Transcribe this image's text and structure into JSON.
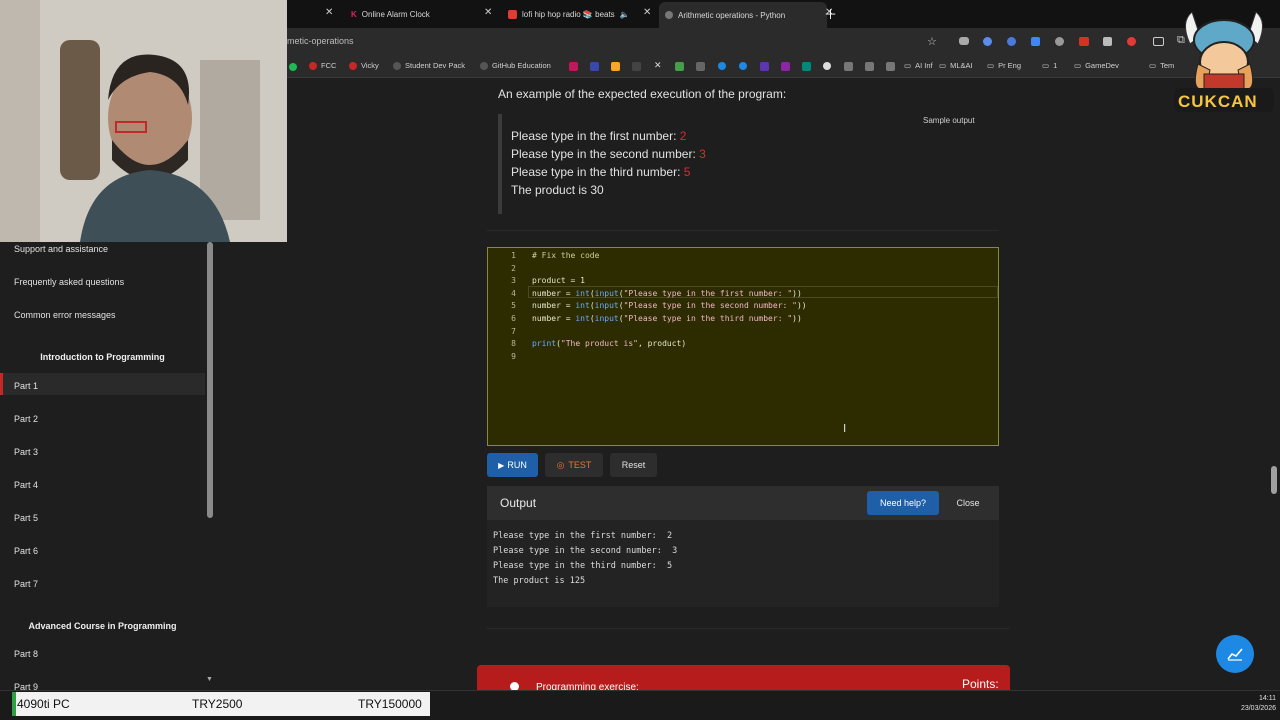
{
  "browser": {
    "tabs": [
      {
        "label": "Online Alarm Clock",
        "active": false
      },
      {
        "label": "lofi hip hop radio 📚 beats",
        "active": false
      },
      {
        "label": "Arithmetic operations - Python",
        "active": true
      }
    ],
    "url": "metic-operations",
    "bookmarks": [
      "FCC",
      "Vicky",
      "Student Dev Pack",
      "GitHub Education",
      "AI Inf",
      "ML&AI",
      "Pr Eng",
      "1",
      "GameDev",
      "Tem"
    ]
  },
  "sidebar": {
    "items_top": [
      "Support and assistance",
      "Frequently asked questions",
      "Common error messages"
    ],
    "heading1": "Introduction to Programming",
    "parts1": [
      "Part 1",
      "Part 2",
      "Part 3",
      "Part 4",
      "Part 5",
      "Part 6",
      "Part 7"
    ],
    "heading2": "Advanced Course in Programming",
    "parts2": [
      "Part 8",
      "Part 9"
    ]
  },
  "sample": {
    "intro": "An example of the expected execution of the program:",
    "badge": "Sample output",
    "lines": [
      {
        "text": "Please type in the first number: ",
        "input": "2"
      },
      {
        "text": "Please type in the second number: ",
        "input": "3"
      },
      {
        "text": "Please type in the third number: ",
        "input": "5"
      },
      {
        "text": "The product is 30",
        "input": ""
      }
    ]
  },
  "editor": {
    "line_numbers": [
      "1",
      "2",
      "3",
      "4",
      "5",
      "6",
      "7",
      "8",
      "9"
    ],
    "comment": "# Fix the code",
    "l3": "product = 1",
    "prompt1": "\"Please type in the first number: \"",
    "prompt2": "\"Please type in the second number: \"",
    "prompt3": "\"Please type in the third number: \"",
    "print_str": "\"The product is\"",
    "kw_number": "number",
    "kw_int": "int",
    "kw_input": "input",
    "kw_print": "print"
  },
  "buttons": {
    "run": "RUN",
    "test": "TEST",
    "reset": "Reset"
  },
  "output": {
    "title": "Output",
    "help": "Need help?",
    "close": "Close",
    "lines": [
      "Please type in the first number:  2",
      "Please type in the second number:  3",
      "Please type in the third number:  5",
      "The product is 125"
    ]
  },
  "exercise": {
    "label": "Programming exercise:",
    "points": "Points:"
  },
  "ticker": {
    "name": "4090ti PC",
    "price1": "TRY2500",
    "price2": "TRY150000"
  },
  "clock": {
    "time": "14:11",
    "date": "23/03/2026"
  },
  "logo": {
    "text": "CUKCAN"
  },
  "colors": {
    "editor_bg": "#2c2c00",
    "run": "#1e5fa8",
    "accent_red": "#b71c1c"
  }
}
